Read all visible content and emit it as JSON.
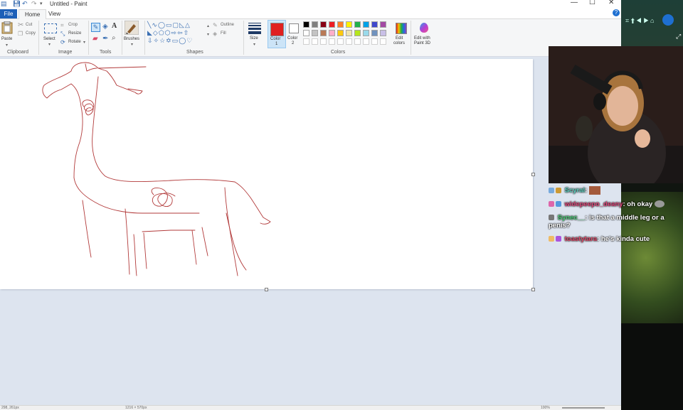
{
  "window": {
    "title": "Untitled - Paint",
    "controls": [
      "—",
      "☐",
      "✕"
    ]
  },
  "tabs": {
    "file": "File",
    "home": "Home",
    "view": "View"
  },
  "ribbon": {
    "clipboard": {
      "paste": "Paste",
      "cut": "Cut",
      "copy": "Copy",
      "label": "Clipboard"
    },
    "image": {
      "select": "Select",
      "crop": "Crop",
      "resize": "Resize",
      "rotate": "Rotate",
      "label": "Image"
    },
    "tools": {
      "label": "Tools"
    },
    "brushes": {
      "label": "Brushes"
    },
    "shapes": {
      "outline": "Outline",
      "fill": "Fill",
      "label": "Shapes"
    },
    "size": {
      "label": "Size"
    },
    "color1": {
      "label": "Color",
      "num": "1",
      "value": "#e02020"
    },
    "color2": {
      "label": "Color",
      "num": "2",
      "value": "#ffffff"
    },
    "colors": {
      "label": "Colors",
      "edit": "Edit",
      "edit2": "colors"
    },
    "paint3d": {
      "label": "Edit with",
      "label2": "Paint 3D"
    },
    "palette_row1": [
      "#000000",
      "#7f7f7f",
      "#880015",
      "#ed1c24",
      "#ff7f27",
      "#fff200",
      "#22b14c",
      "#00a2e8",
      "#3f48cc",
      "#a349a4"
    ],
    "palette_row2": [
      "#ffffff",
      "#c3c3c3",
      "#b97a57",
      "#ffaec9",
      "#ffc90e",
      "#efe4b0",
      "#b5e61d",
      "#99d9ea",
      "#7092be",
      "#c8bfe7"
    ],
    "palette_row3": [
      "#ffffff",
      "#ffffff",
      "#ffffff",
      "#ffffff",
      "#ffffff",
      "#ffffff",
      "#ffffff",
      "#ffffff",
      "#ffffff",
      "#ffffff"
    ]
  },
  "status": {
    "cursor": "298, 261px",
    "size": "1216 × 570px",
    "zoom": "100%"
  },
  "chat": [
    {
      "user": "Scyral",
      "message": "",
      "color": "#5fd3c3"
    },
    {
      "user": "widepeepo_deany",
      "message": "oh okay",
      "color": "#e0467a"
    },
    {
      "user": "Synec__",
      "message": "is that a middle leg or a penis?",
      "color": "#4fd07a"
    },
    {
      "user": "toastytara",
      "message": "he's kinda cute",
      "color": "#e04a6a"
    }
  ]
}
